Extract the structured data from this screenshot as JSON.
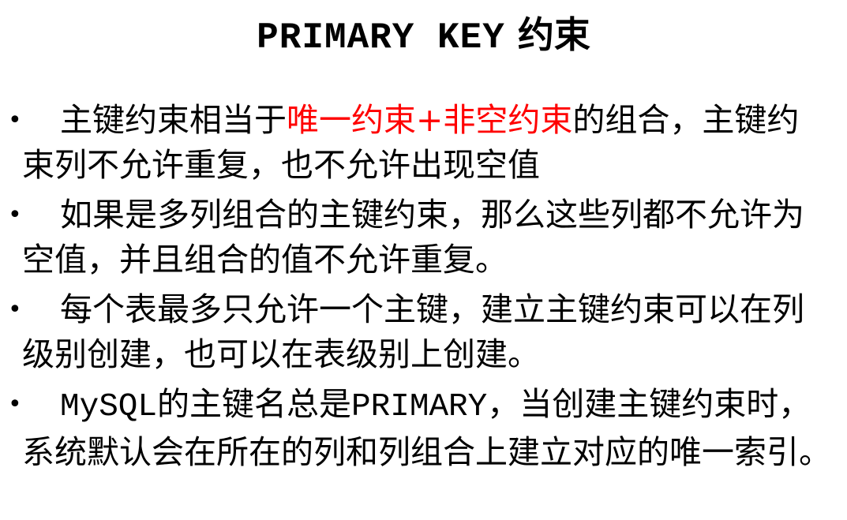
{
  "title": {
    "latin": "PRIMARY KEY",
    "cjk": "约束"
  },
  "bullets": [
    {
      "marker": "•",
      "part1": "主键约束相当于",
      "highlight": "唯一约束+非空约束",
      "part2": "的组合，主键约束列不允许重复，也不允许出现空值"
    },
    {
      "marker": "•",
      "text": "如果是多列组合的主键约束，那么这些列都不允许为空值，并且组合的值不允许重复。"
    },
    {
      "marker": "•",
      "text": "每个表最多只允许一个主键，建立主键约束可以在列级别创建，也可以在表级别上创建。"
    },
    {
      "marker": "•",
      "mono1": "MySQL",
      "part1": "的主键名总是",
      "mono2": "PRIMARY",
      "part2": "，当创建主键约束时，系统默认会在所在的列和列组合上建立对应的唯一索引。"
    }
  ],
  "colors": {
    "highlight": "#ff0000",
    "text": "#000000",
    "background": "#ffffff"
  }
}
